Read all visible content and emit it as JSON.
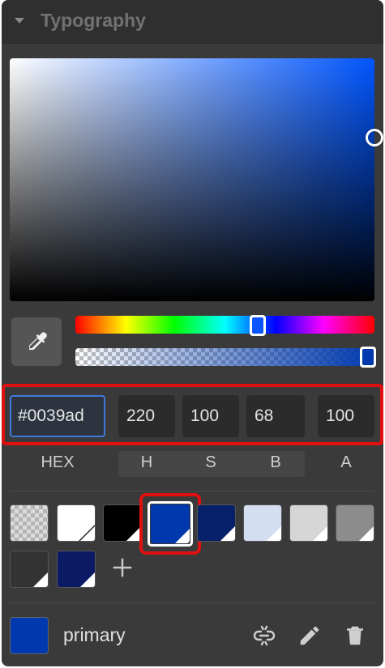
{
  "section": {
    "title": "Typography"
  },
  "color": {
    "hex_value": "#0039ad",
    "hue": "220",
    "saturation": "100",
    "brightness": "68",
    "alpha": "100",
    "hue_fraction": 0.61,
    "alpha_fraction": 1.0,
    "picker_base_color": "#0055ff"
  },
  "labels": {
    "hex": "HEX",
    "h": "H",
    "s": "S",
    "b": "B",
    "a": "A"
  },
  "swatches": [
    {
      "id": "transparent",
      "color": "transparent"
    },
    {
      "id": "white",
      "color": "#ffffff"
    },
    {
      "id": "black",
      "color": "#000000"
    },
    {
      "id": "primary",
      "color": "#0039ad",
      "selected": true
    },
    {
      "id": "navy",
      "color": "#07206a"
    },
    {
      "id": "light-blue",
      "color": "#d3dff1"
    },
    {
      "id": "light-gray",
      "color": "#d6d6d6"
    },
    {
      "id": "gray",
      "color": "#8c8c8c"
    },
    {
      "id": "dark-gray",
      "color": "#333333"
    },
    {
      "id": "dark-navy",
      "color": "#0c1a66"
    }
  ],
  "current": {
    "name": "primary",
    "color": "#0039ad"
  },
  "icons": {
    "eyedropper": "eyedropper-icon",
    "unlink": "unlink-icon",
    "edit": "pencil-icon",
    "delete": "trash-icon",
    "add": "plus-icon",
    "collapse": "caret-down-icon"
  },
  "accent": {
    "highlight": "#e01010",
    "focus": "#3f7ad9"
  }
}
